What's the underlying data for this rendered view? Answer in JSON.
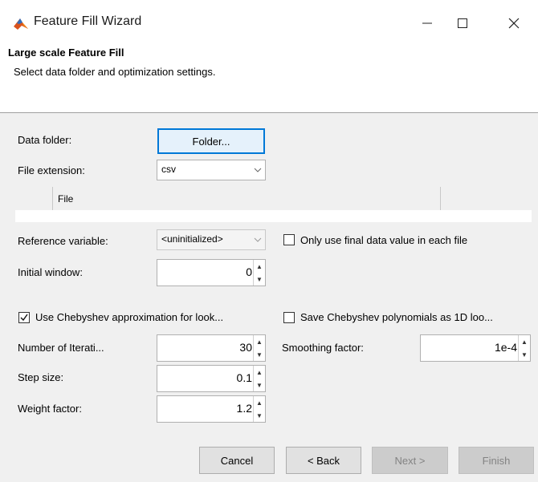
{
  "window": {
    "title": "Feature Fill Wizard",
    "icon": "matlab-icon",
    "buttons": [
      "minimize-icon",
      "maximize-icon",
      "close-icon"
    ]
  },
  "header": {
    "title": "Large scale Feature Fill",
    "subtitle": "Select data folder and optimization settings."
  },
  "form": {
    "data_folder_label": "Data folder:",
    "folder_button": "Folder...",
    "file_extension_label": "File extension:",
    "file_extension_value": "csv",
    "table_column": "File",
    "reference_variable_label": "Reference variable:",
    "reference_variable_value": "<uninitialized>",
    "only_final_label": "Only use final data value in each file",
    "only_final_checked": false,
    "initial_window_label": "Initial window:",
    "initial_window_value": "0",
    "use_chebyshev_label": "Use Chebyshev approximation for look...",
    "use_chebyshev_checked": true,
    "save_chebyshev_label": "Save Chebyshev polynomials as 1D loo...",
    "save_chebyshev_checked": false,
    "iterations_label": "Number of Iterati...",
    "iterations_value": "30",
    "smoothing_label": "Smoothing factor:",
    "smoothing_value": "1e-4",
    "step_size_label": "Step size:",
    "step_size_value": "0.1",
    "weight_factor_label": "Weight factor:",
    "weight_factor_value": "1.2"
  },
  "footer": {
    "cancel": "Cancel",
    "back": "< Back",
    "next": "Next >",
    "finish": "Finish"
  },
  "colors": {
    "body_bg": "#f0f0f0",
    "primary_border": "#0078d7",
    "disabled_bg": "#cccccc"
  }
}
